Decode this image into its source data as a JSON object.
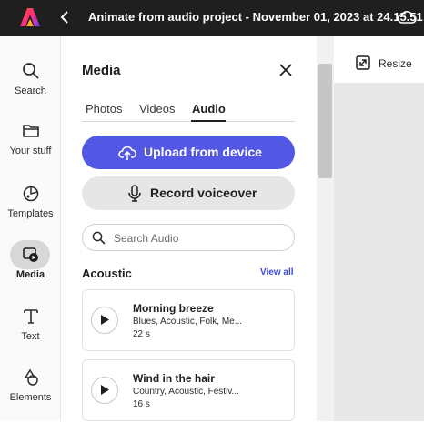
{
  "topbar": {
    "title": "Animate from audio project - November 01, 2023 at 24.15.51",
    "brand_color": "#eb1000"
  },
  "rail": {
    "items": [
      {
        "label": "Search",
        "icon": "search-icon"
      },
      {
        "label": "Your stuff",
        "icon": "folder-icon"
      },
      {
        "label": "Templates",
        "icon": "templates-icon"
      },
      {
        "label": "Media",
        "icon": "media-icon",
        "active": true
      },
      {
        "label": "Text",
        "icon": "text-icon"
      },
      {
        "label": "Elements",
        "icon": "elements-icon"
      }
    ]
  },
  "panel": {
    "title": "Media",
    "tabs": [
      {
        "label": "Photos"
      },
      {
        "label": "Videos"
      },
      {
        "label": "Audio",
        "active": true
      }
    ],
    "upload_label": "Upload from device",
    "record_label": "Record voiceover",
    "search_placeholder": "Search Audio",
    "section_title": "Acoustic",
    "view_all": "View all",
    "accent_color": "#5258e4",
    "tracks": [
      {
        "title": "Morning breeze",
        "tags": "Blues, Acoustic, Folk, Me...",
        "duration": "22 s"
      },
      {
        "title": "Wind in the hair",
        "tags": "Country, Acoustic, Festiv...",
        "duration": "16 s"
      }
    ]
  },
  "canvas": {
    "resize_label": "Resize"
  }
}
